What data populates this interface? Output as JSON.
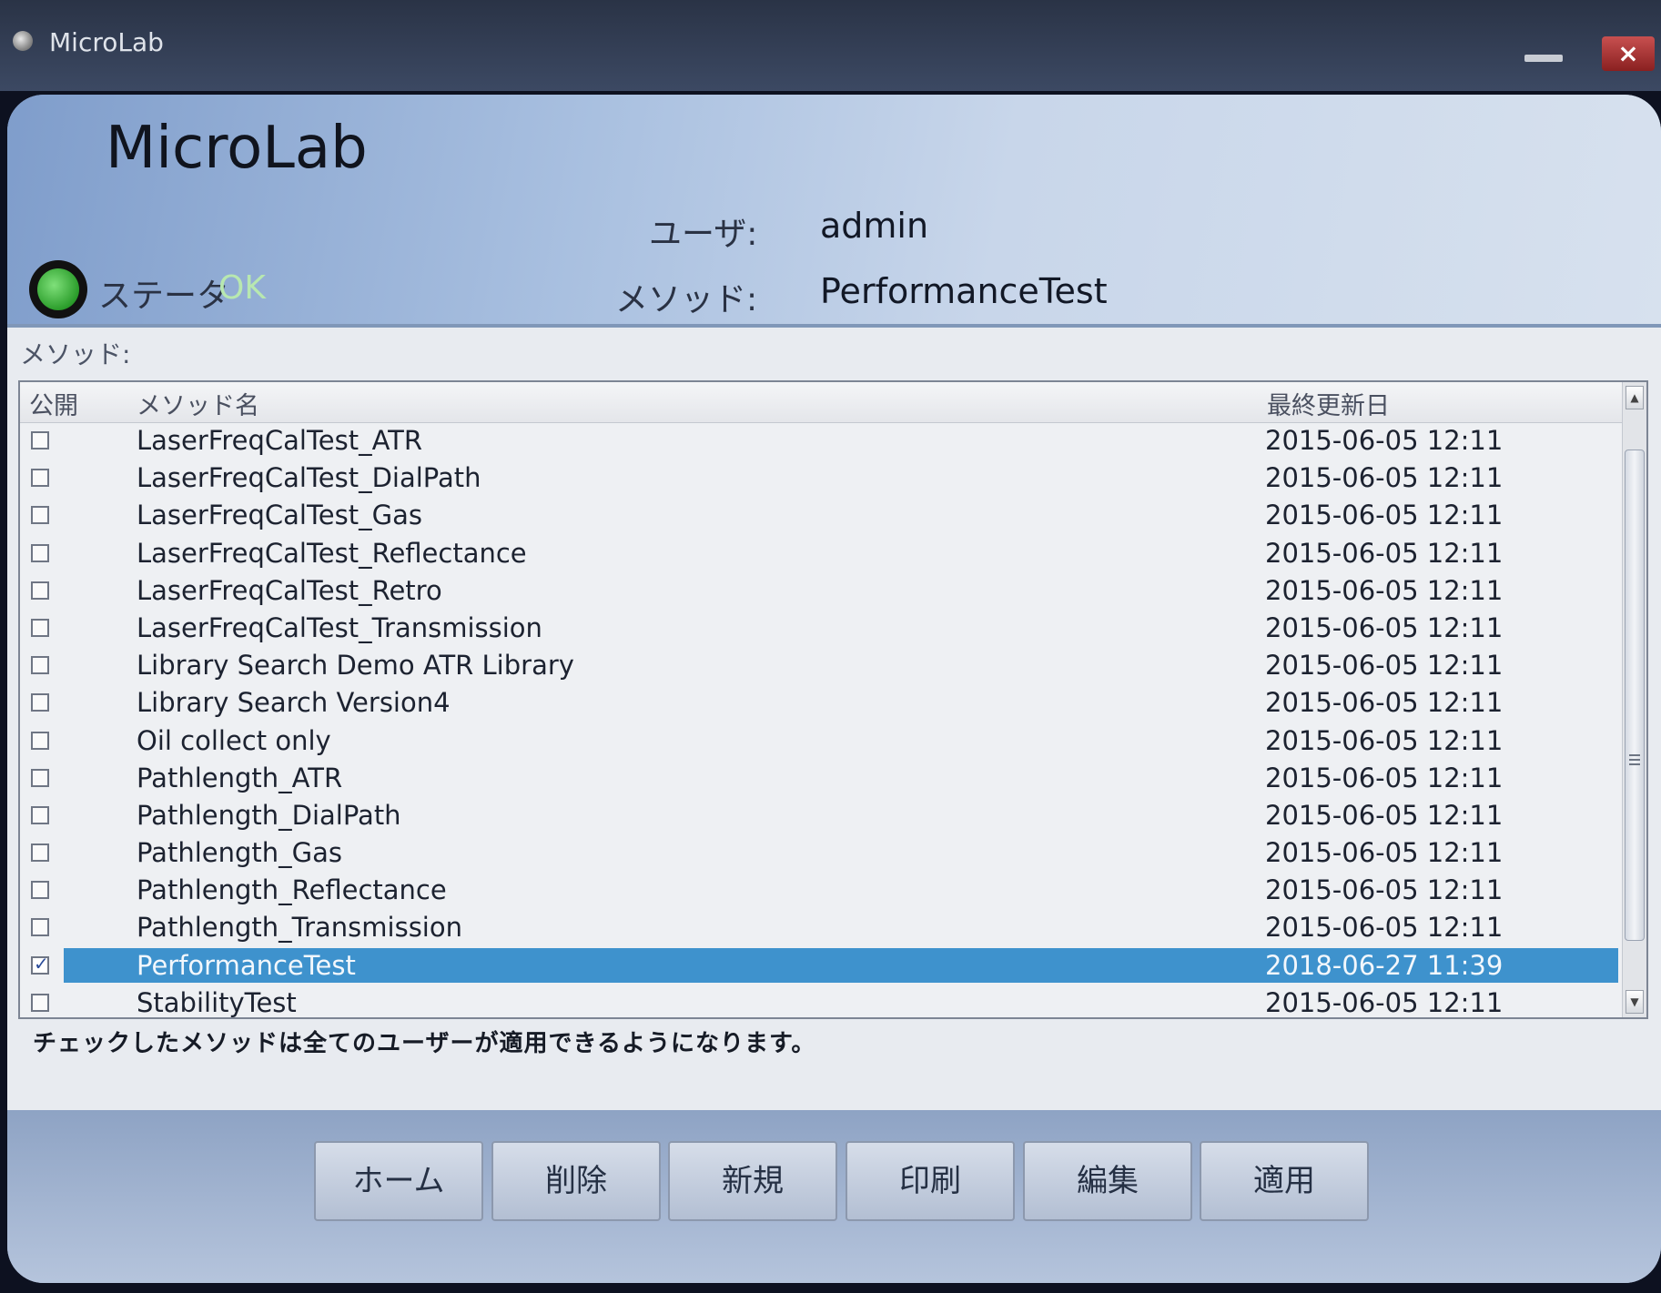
{
  "titlebar": {
    "title": "MicroLab",
    "close_label": "×"
  },
  "header": {
    "title": "MicroLab",
    "user_label": "ユーザ:",
    "user_value": "admin",
    "method_label": "メソッド:",
    "method_value": "PerformanceTest",
    "status_label": "ステータ",
    "status_value": "OK"
  },
  "content": {
    "section_label": "メソッド:",
    "columns": [
      "公開",
      "メソッド名",
      "最終更新日"
    ],
    "rows": [
      {
        "name": "LaserFreqCalTest_ATR",
        "date": "2015-06-05  12:11",
        "public": false
      },
      {
        "name": "LaserFreqCalTest_DialPath",
        "date": "2015-06-05  12:11",
        "public": false
      },
      {
        "name": "LaserFreqCalTest_Gas",
        "date": "2015-06-05  12:11",
        "public": false
      },
      {
        "name": "LaserFreqCalTest_Reflectance",
        "date": "2015-06-05  12:11",
        "public": false
      },
      {
        "name": "LaserFreqCalTest_Retro",
        "date": "2015-06-05  12:11",
        "public": false
      },
      {
        "name": "LaserFreqCalTest_Transmission",
        "date": "2015-06-05  12:11",
        "public": false
      },
      {
        "name": "Library Search Demo ATR Library",
        "date": "2015-06-05  12:11",
        "public": false
      },
      {
        "name": "Library Search Version4",
        "date": "2015-06-05  12:11",
        "public": false
      },
      {
        "name": "Oil collect only",
        "date": "2015-06-05  12:11",
        "public": false
      },
      {
        "name": "Pathlength_ATR",
        "date": "2015-06-05  12:11",
        "public": false
      },
      {
        "name": "Pathlength_DialPath",
        "date": "2015-06-05  12:11",
        "public": false
      },
      {
        "name": "Pathlength_Gas",
        "date": "2015-06-05  12:11",
        "public": false
      },
      {
        "name": "Pathlength_Reflectance",
        "date": "2015-06-05  12:11",
        "public": false
      },
      {
        "name": "Pathlength_Transmission",
        "date": "2015-06-05  12:11",
        "public": false
      },
      {
        "name": "PerformanceTest",
        "date": "2018-06-27  11:39",
        "public": true,
        "selected": true
      },
      {
        "name": "StabilityTest",
        "date": "2015-06-05  12:11",
        "public": false
      }
    ],
    "footnote": "チェックしたメソッドは全てのユーザーが適用できるようになります。"
  },
  "buttons": {
    "home": "ホーム",
    "delete": "削除",
    "new": "新規",
    "print": "印刷",
    "edit": "編集",
    "apply": "適用"
  }
}
